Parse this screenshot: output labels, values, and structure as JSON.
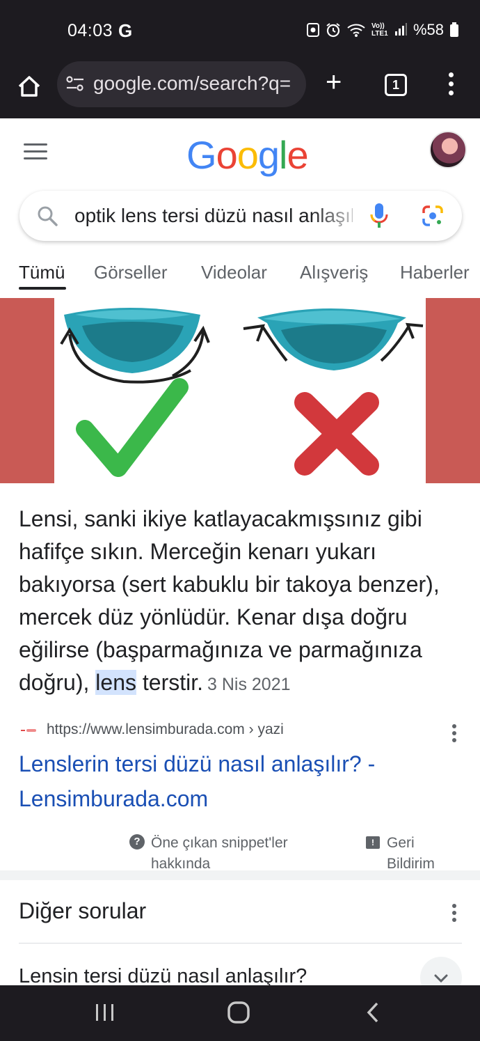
{
  "status_bar": {
    "time": "04:03",
    "g_label": "G",
    "battery_text": "%58",
    "network_label": "Vo)) LTE1"
  },
  "browser": {
    "url": "google.com/search?q=",
    "tab_count": "1"
  },
  "google": {
    "logo_letters": [
      "G",
      "o",
      "o",
      "g",
      "l",
      "e"
    ],
    "logo_colors": [
      "#4285f4",
      "#ea4335",
      "#fbbc05",
      "#4285f4",
      "#34a853",
      "#ea4335"
    ]
  },
  "search": {
    "query": "optik lens tersi düzü nasıl anlaşılır"
  },
  "tabs": [
    "Tümü",
    "Görseller",
    "Videolar",
    "Alışveriş",
    "Haberler"
  ],
  "snippet": {
    "text_before": "Lensi, sanki ikiye katlayacakmışsınız gibi hafifçe sıkın. Merceğin kenarı yukarı bakıyorsa (sert kabuklu bir takoya benzer), mercek düz yönlüdür. Kenar dışa doğru eğilirse (başparmağınıza ve parmağınıza doğru), ",
    "highlight": "lens",
    "text_after": " terstir.",
    "date": "3 Nis 2021"
  },
  "result": {
    "source_url": "https://www.lensimburada.com › yazi",
    "title": "Lenslerin tersi düzü nasıl anlaşılır? - Lensimburada.com"
  },
  "about_snippets": "Öne çıkan snippet'ler hakkında",
  "feedback": "Geri Bildirim",
  "other_questions": {
    "heading": "Diğer sorular",
    "items": [
      "Lensin tersi düzü nasıl anlaşılır?"
    ]
  }
}
